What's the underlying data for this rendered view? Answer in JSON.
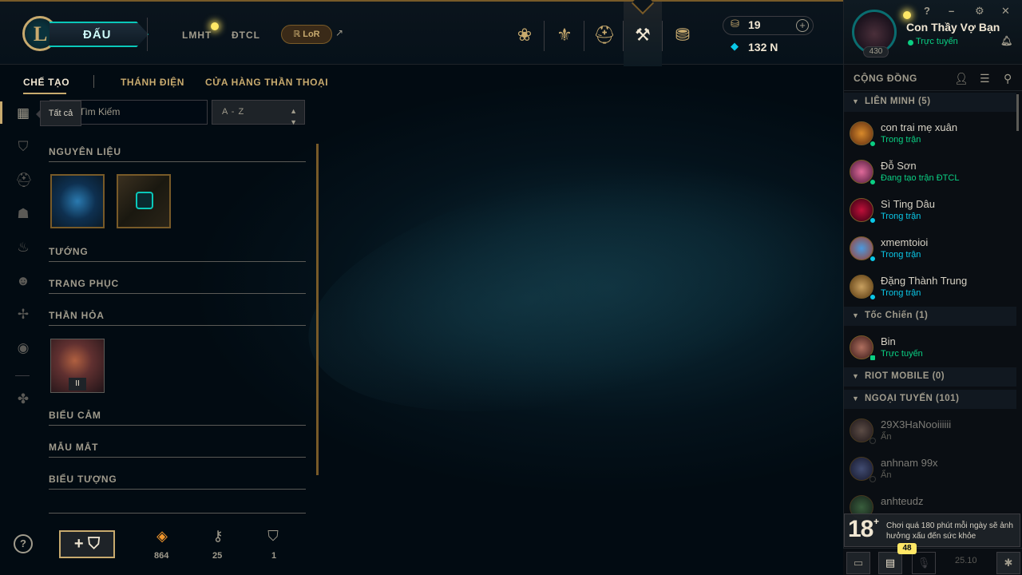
{
  "header": {
    "play_label": "ĐẤU",
    "nav": [
      "LMHT",
      "ĐTCL"
    ],
    "lor_label": "LoR",
    "rp": "19",
    "be": "132 N"
  },
  "profile": {
    "name": "Con Thầy Vợ Bạn",
    "status": "Trực tuyến",
    "level": "430"
  },
  "window_controls": [
    "?",
    "–",
    "⚙",
    "✕"
  ],
  "community": {
    "title": "CỘNG ĐỒNG",
    "groups": [
      {
        "label": "LIÊN MINH (5)",
        "friends": [
          {
            "name": "con trai mẹ xuân",
            "status": "Trong trận",
            "status_color": "#0acf83"
          },
          {
            "name": "Đỗ Sơn",
            "status": "Đang tạo trận ĐTCL",
            "status_color": "#0acf83"
          },
          {
            "name": "Sì Ting Dâu",
            "status": "Trong trận",
            "status_color": "#0ac8e8"
          },
          {
            "name": "xmemtoioi",
            "status": "Trong trận",
            "status_color": "#0ac8e8"
          },
          {
            "name": "Đặng Thành Trung",
            "status": "Trong trận",
            "status_color": "#0ac8e8"
          }
        ]
      },
      {
        "label": "Tốc Chiến (1)",
        "friends": [
          {
            "name": "Bin",
            "status": "Trực tuyến",
            "status_color": "#0acf83"
          }
        ]
      },
      {
        "label": "RIOT MOBILE (0)",
        "friends": []
      },
      {
        "label": "NGOẠI TUYẾN (101)",
        "friends": [
          {
            "name": "29X3HaNooiiiiii",
            "status": "Ẩn",
            "status_color": "#5b5a56"
          },
          {
            "name": "anhnam 99x",
            "status": "Ẩn",
            "status_color": "#5b5a56"
          },
          {
            "name": "anhteudz",
            "status": "",
            "status_color": "#5b5a56"
          }
        ]
      }
    ]
  },
  "notice": {
    "age": "18",
    "text": "Chơi quá 180 phút mỗi ngày sẽ ảnh hưởng xấu đến sức khỏe"
  },
  "bottom": {
    "badge": "48",
    "version": "25.10"
  },
  "crafting": {
    "tabs": [
      "CHẾ TẠO",
      "THÁNH ĐIỆN",
      "CỬA HÀNG THẦN THOẠI"
    ],
    "tooltip": "Tất cả",
    "search_placeholder": "Tìm Kiếm",
    "sort_value": "A - Z",
    "sections": [
      "NGUYÊN LIỆU",
      "TƯỚNG",
      "TRANG PHỤC",
      "THẦN HỎA",
      "BIỂU CẢM",
      "MẪU MẮT",
      "BIỂU TƯỢNG"
    ],
    "emote_tile_label": "II",
    "stats": {
      "orange_essence": "864",
      "keys": "25",
      "chests": "1"
    },
    "help": "?",
    "craft_plus": "+"
  }
}
